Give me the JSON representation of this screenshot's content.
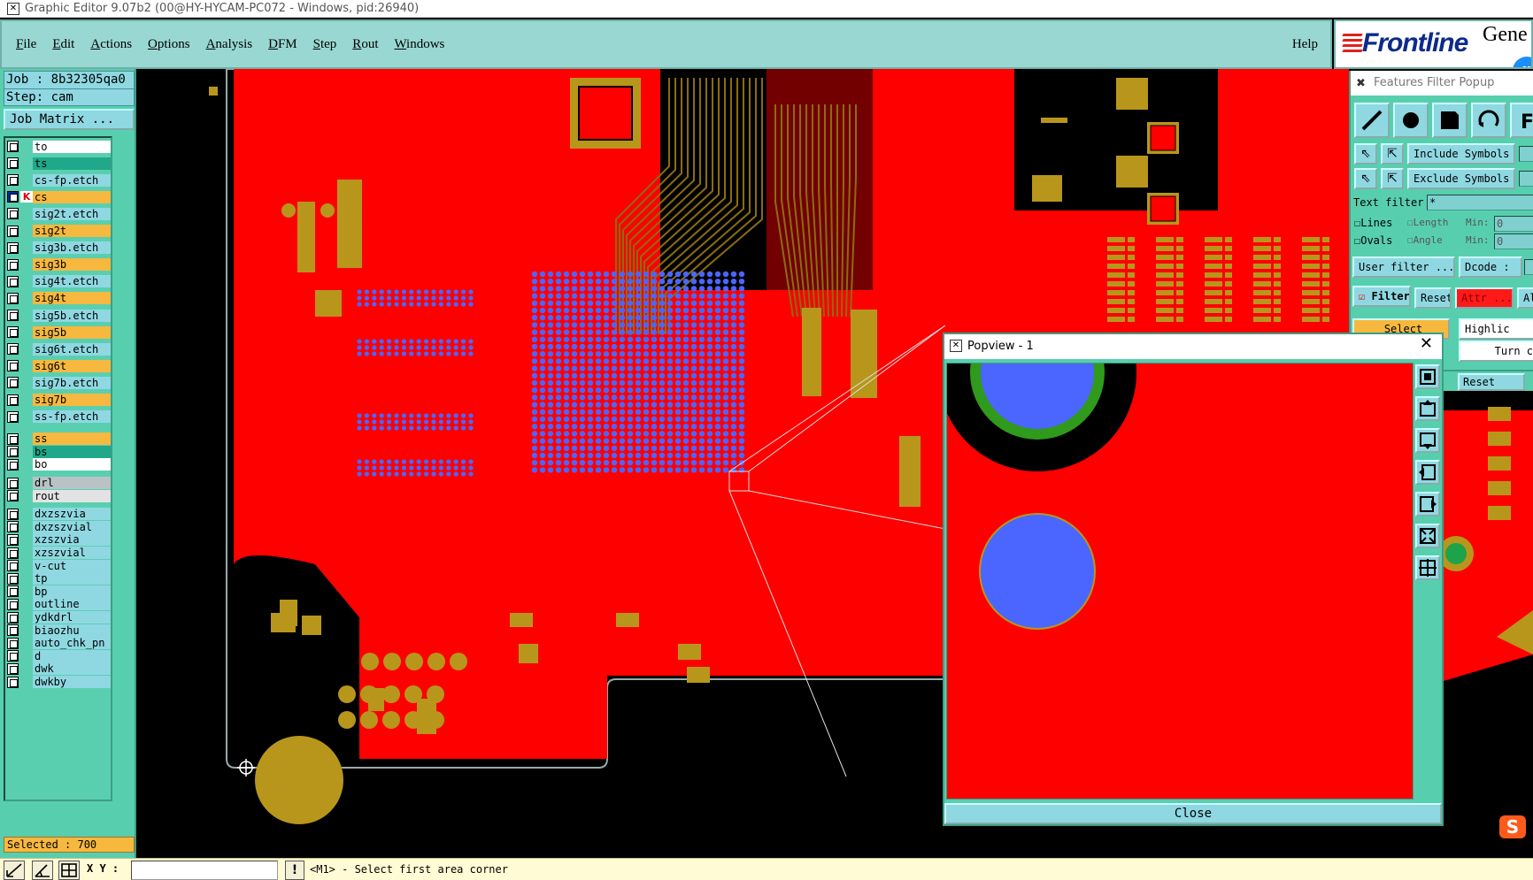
{
  "window": {
    "title": "Graphic Editor 9.07b2 (00@HY-HYCAM-PC072 - Windows, pid:26940)",
    "icon": "x-app-icon"
  },
  "menu": {
    "items": [
      "File",
      "Edit",
      "Actions",
      "Options",
      "Analysis",
      "DFM",
      "Step",
      "Rout",
      "Windows"
    ],
    "help": "Help"
  },
  "brand": {
    "logo": "Frontline",
    "partial_text": "Gene"
  },
  "job": {
    "job_line": "Job : 8b32305qa0",
    "step_line": "Step: cam",
    "job_matrix": "Job Matrix ..."
  },
  "layers": [
    {
      "name": "to",
      "color": "#ffffff",
      "group": 1
    },
    {
      "name": "ts",
      "color": "#1fa98a",
      "group": 1
    },
    {
      "name": "cs-fp.etch",
      "color": "#8fd8e2",
      "group": 1
    },
    {
      "name": "cs",
      "color": "#f6b83e",
      "group": 1,
      "active": true,
      "marker": "K"
    },
    {
      "name": "sig2t.etch",
      "color": "#8fd8e2",
      "group": 1
    },
    {
      "name": "sig2t",
      "color": "#f6b83e",
      "group": 1
    },
    {
      "name": "sig3b.etch",
      "color": "#8fd8e2",
      "group": 1
    },
    {
      "name": "sig3b",
      "color": "#f6b83e",
      "group": 1
    },
    {
      "name": "sig4t.etch",
      "color": "#8fd8e2",
      "group": 1
    },
    {
      "name": "sig4t",
      "color": "#f6b83e",
      "group": 1
    },
    {
      "name": "sig5b.etch",
      "color": "#8fd8e2",
      "group": 1
    },
    {
      "name": "sig5b",
      "color": "#f6b83e",
      "group": 1
    },
    {
      "name": "sig6t.etch",
      "color": "#8fd8e2",
      "group": 1
    },
    {
      "name": "sig6t",
      "color": "#f6b83e",
      "group": 1
    },
    {
      "name": "sig7b.etch",
      "color": "#8fd8e2",
      "group": 1
    },
    {
      "name": "sig7b",
      "color": "#f6b83e",
      "group": 1
    },
    {
      "name": "ss-fp.etch",
      "color": "#8fd8e2",
      "group": 1
    },
    {
      "name": "ss",
      "color": "#f6b83e",
      "group": 2
    },
    {
      "name": "bs",
      "color": "#1fa98a",
      "group": 2
    },
    {
      "name": "bo",
      "color": "#ffffff",
      "group": 2
    },
    {
      "name": "drl",
      "color": "#b9c3c6",
      "group": 3
    },
    {
      "name": "rout",
      "color": "#e3e3e3",
      "group": 3
    },
    {
      "name": "dxzszvia",
      "color": "#8fd8e2",
      "group": 4
    },
    {
      "name": "dxzszvial",
      "color": "#8fd8e2",
      "group": 4
    },
    {
      "name": "xzszvia",
      "color": "#8fd8e2",
      "group": 4
    },
    {
      "name": "xzszvial",
      "color": "#8fd8e2",
      "group": 4
    },
    {
      "name": "v-cut",
      "color": "#8fd8e2",
      "group": 4
    },
    {
      "name": "tp",
      "color": "#8fd8e2",
      "group": 4
    },
    {
      "name": "bp",
      "color": "#8fd8e2",
      "group": 4
    },
    {
      "name": "outline",
      "color": "#8fd8e2",
      "group": 4
    },
    {
      "name": "ydkdrl",
      "color": "#8fd8e2",
      "group": 4
    },
    {
      "name": "biaozhu",
      "color": "#8fd8e2",
      "group": 4
    },
    {
      "name": "auto_chk_pn",
      "color": "#8fd8e2",
      "group": 4
    },
    {
      "name": "d",
      "color": "#8fd8e2",
      "group": 4
    },
    {
      "name": "dwk",
      "color": "#8fd8e2",
      "group": 4
    },
    {
      "name": "dwkby",
      "color": "#8fd8e2",
      "group": 4
    }
  ],
  "selected_count": "Selected : 700",
  "features_filter": {
    "title": "Features Filter Popup",
    "tool_icons": [
      "line-icon",
      "pad-icon",
      "surface-icon",
      "arc-icon",
      "text-icon"
    ],
    "include_symbols": "Include Symbols :",
    "exclude_symbols": "Exclude Symbols :",
    "text_filter_label": "Text filter",
    "text_filter_value": "*",
    "lines": "Lines",
    "ovals": "Ovals",
    "length": "Length",
    "angle": "Angle",
    "min": "Min:",
    "min_value": "0",
    "user_filter": "User filter ...",
    "dcode": "Dcode :",
    "filter": "Filter",
    "reset": "Reset",
    "attr": "Attr ...",
    "all": "Al",
    "select": "Select",
    "highlight": "Highlic",
    "turn": "Turn c",
    "reset2": "Reset"
  },
  "popview": {
    "title": "Popview - 1",
    "close": "Close",
    "tool_icons": [
      "zoom-icon",
      "zoom-in-icon",
      "zoom-out-icon",
      "pan-left-icon",
      "pan-right-icon",
      "fit-icon",
      "center-icon"
    ]
  },
  "status": {
    "xy_label": "X Y :",
    "xy_value": "",
    "warn": "!",
    "message": "<M1> - Select first area corner"
  },
  "colors": {
    "board": "#ff0000",
    "copper": "#b8961b",
    "via": "#4b66ff",
    "panel": "#57cfae",
    "menu": "#99d8d2"
  }
}
